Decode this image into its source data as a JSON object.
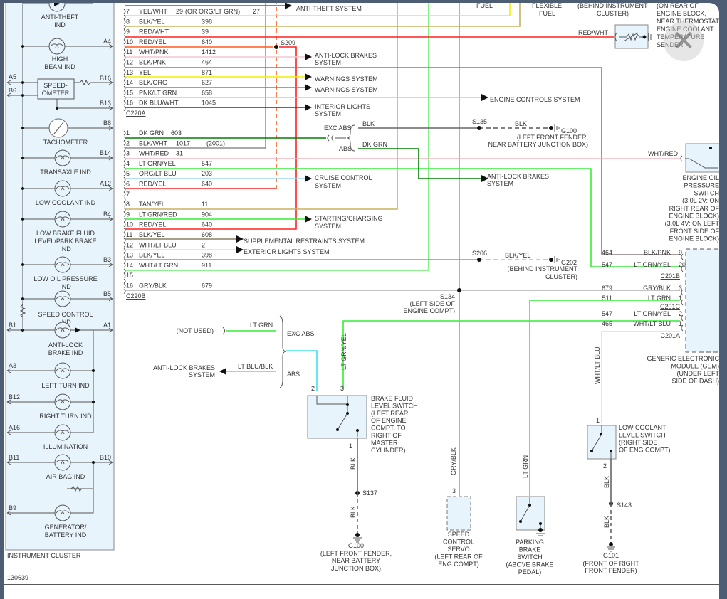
{
  "colors": {
    "frame": "#4d5d73",
    "cluster_fill": "#e8f4fc",
    "yellow": "#f0f000",
    "red": "#ff2020",
    "orange_red": "#ff5a1e",
    "pink": "#f4b4bc",
    "lt_green": "#33ee33",
    "dk_green": "#008000",
    "navy": "#1a3399",
    "gray": "#a0a0a0",
    "tan": "#c8b060",
    "cyan": "#40e0f0",
    "lt_blue": "#b8ecf4"
  },
  "figure_id": "130639",
  "cluster": {
    "label": "INSTRUMENT CLUSTER",
    "items": [
      {
        "label": [
          "ANTI-THEFT",
          "IND"
        ],
        "left": "",
        "right": ""
      },
      {
        "label": [
          "HIGH",
          "BEAM IND"
        ],
        "left": "",
        "right": "A4"
      },
      {
        "label": [
          "SPEED-",
          "OMETER"
        ],
        "left": "A5",
        "left2": "B6",
        "right": "B16",
        "right2": "B13"
      },
      {
        "label": [
          "TACHOMETER"
        ],
        "left": "",
        "right": "B8"
      },
      {
        "label": [
          "TRANSAXLE IND"
        ],
        "left": "",
        "right": "B14"
      },
      {
        "label": [
          "LOW COOLANT IND"
        ],
        "left": "",
        "right": "A12"
      },
      {
        "label": [
          "LOW BRAKE FLUID",
          "LEVEL/PARK BRAKE",
          "IND"
        ],
        "left": "",
        "right": "B4"
      },
      {
        "label": [
          "LOW OIL PRESSURE",
          "IND"
        ],
        "left": "",
        "right": "B3"
      },
      {
        "label": [
          "SPEED CONTROL",
          "IND"
        ],
        "left": "",
        "right": "B5"
      },
      {
        "label": [
          "ANTI-LOCK",
          "BRAKE IND"
        ],
        "left": "B1",
        "right": "A1"
      },
      {
        "label": [
          "LEFT TURN IND"
        ],
        "left": "A3",
        "right": ""
      },
      {
        "label": [
          "RIGHT TURN IND"
        ],
        "left": "B12",
        "right": ""
      },
      {
        "label": [
          "ILLUMINATION"
        ],
        "left": "A16",
        "right": ""
      },
      {
        "label": [
          "AIR BAG IND"
        ],
        "left": "B11",
        "right": "B10"
      },
      {
        "label": [
          "GENERATOR/",
          "BATTERY IND"
        ],
        "left": "B9",
        "right": ""
      }
    ]
  },
  "c220a": {
    "label": "C220A",
    "rows": [
      {
        "pin": "7",
        "color": "YEL/WHT",
        "circuit": "29",
        "note": "(OR ORG/LT GRN)",
        "circuit2": "27"
      },
      {
        "pin": "8",
        "color": "BLK/YEL",
        "circuit": "398"
      },
      {
        "pin": "9",
        "color": "RED/WHT",
        "circuit": "39"
      },
      {
        "pin": "10",
        "color": "RED/YEL",
        "circuit": "640"
      },
      {
        "pin": "11",
        "color": "WHT/PNK",
        "circuit": "1412"
      },
      {
        "pin": "12",
        "color": "BLK/PNK",
        "circuit": "464"
      },
      {
        "pin": "13",
        "color": "YEL",
        "circuit": "871"
      },
      {
        "pin": "14",
        "color": "BLK/ORG",
        "circuit": "627"
      },
      {
        "pin": "15",
        "color": "PNK/LT GRN",
        "circuit": "658"
      },
      {
        "pin": "16",
        "color": "DK BLU/WHT",
        "circuit": "1045"
      }
    ]
  },
  "c220b": {
    "label": "C220B",
    "rows": [
      {
        "pin": "1",
        "color": "DK GRN",
        "circuit": "603"
      },
      {
        "pin": "2",
        "color": "BLK/WHT",
        "circuit": "1017",
        "note": "(2001)"
      },
      {
        "pin": "3",
        "color": "WHT/RED",
        "circuit": "31"
      },
      {
        "pin": "4",
        "color": "LT GRN/YEL",
        "circuit": "547"
      },
      {
        "pin": "5",
        "color": "ORG/LT BLU",
        "circuit": "203"
      },
      {
        "pin": "6",
        "color": "RED/YEL",
        "circuit": "640"
      },
      {
        "pin": "7",
        "color": "",
        "circuit": ""
      },
      {
        "pin": "8",
        "color": "TAN/YEL",
        "circuit": "11"
      },
      {
        "pin": "9",
        "color": "LT GRN/RED",
        "circuit": "904"
      },
      {
        "pin": "10",
        "color": "RED/YEL",
        "circuit": "640"
      },
      {
        "pin": "11",
        "color": "BLK/YEL",
        "circuit": "608"
      },
      {
        "pin": "12",
        "color": "WHT/LT BLU",
        "circuit": "2"
      },
      {
        "pin": "13",
        "color": "BLK/YEL",
        "circuit": "398"
      },
      {
        "pin": "14",
        "color": "WHT/LT GRN",
        "circuit": "911"
      },
      {
        "pin": "15",
        "color": "",
        "circuit": ""
      },
      {
        "pin": "16",
        "color": "GRY/BLK",
        "circuit": "679"
      }
    ]
  },
  "systems": {
    "anti_theft": "ANTI-THEFT SYSTEM",
    "abs_1": [
      "ANTI-LOCK BRAKES",
      "SYSTEM"
    ],
    "warnings_1": "WARNINGS SYSTEM",
    "warnings_2": "WARNINGS SYSTEM",
    "engine_controls": "ENGINE CONTROLS SYSTEM",
    "interior_lights": [
      "INTERIOR LIGHTS",
      "SYSTEM"
    ],
    "cruise": [
      "CRUISE CONTROL",
      "SYSTEM"
    ],
    "starting": [
      "STARTING/CHARGING",
      "SYSTEM"
    ],
    "srs": "SUPPLEMENTAL RESTRAINTS SYSTEM",
    "exterior": "EXTERIOR LIGHTS SYSTEM",
    "abs_2": [
      "ANTI-LOCK BRAKES",
      "SYSTEM"
    ],
    "abs_3": [
      "ANTI-LOCK BRAKES",
      "SYSTEM"
    ]
  },
  "top": {
    "fuel": "FUEL",
    "flex": [
      "FLEXIBLE",
      "FUEL"
    ],
    "behind": [
      "(BEHIND INSTRUMENT",
      "CLUSTER)"
    ],
    "sender": [
      "(ON REAR OF",
      "ENGINE BLOCK,",
      "NEAR THERMOSTAT)",
      "ENGINE COOLANT",
      "TEMPERATURE",
      "SENDER"
    ],
    "red_wht": "RED/WHT"
  },
  "splices": {
    "s209": "S209",
    "s135": "S135",
    "s206": "S206",
    "s134": "S134",
    "s134_loc": [
      "(LEFT SIDE OF",
      "ENGINE COMPT)"
    ],
    "s137": "S137",
    "s143": "S143"
  },
  "abs_select": {
    "exc_abs": "EXC ABS",
    "abs": "ABS",
    "blk": "BLK",
    "dk_grn": "DK GRN"
  },
  "grounds": {
    "g100_top": {
      "wire": "BLK",
      "name": "G100",
      "loc": [
        "(LEFT FRONT FENDER,",
        "NEAR BATTERY JUNCTION BOX)"
      ]
    },
    "g202": {
      "wire": "BLK/YEL",
      "name": "G202",
      "loc": [
        "(BEHIND INSTRUMENT",
        "CLUSTER)"
      ]
    },
    "g100_bot": {
      "wire1": "BLK",
      "wire2": "BLK",
      "name": "G100",
      "loc": [
        "(LEFT FRONT FENDER,",
        "NEAR BATTERY",
        "JUNCTION BOX)"
      ]
    },
    "g101": {
      "wire1": "BLK",
      "wire2": "BLK",
      "name": "G101",
      "loc": [
        "(FRONT OF RIGHT",
        "FRONT FENDER)"
      ]
    }
  },
  "oil_switch": {
    "wire": "WHT/RED",
    "label": [
      "ENGINE OIL",
      "PRESSURE",
      "SWITCH",
      "(3.0L 2V: ON",
      "RIGHT REAR OF",
      "ENGINE BLOCK)",
      "(3.0L 4V: ON LEFT",
      "FRONT SIDE OF",
      "ENGINE BLOCK)"
    ]
  },
  "gem": {
    "label": [
      "GENERIC ELECTRONIC",
      "MODULE (GEM)",
      "(UNDER LEFT",
      "SIDE OF DASH)"
    ],
    "pins": [
      {
        "circuit": "464",
        "color": "BLK/PNK",
        "pin": "9"
      },
      {
        "circuit": "547",
        "color": "LT GRN/YEL",
        "pin": "20"
      },
      {
        "circuit": "679",
        "color": "GRY/BLK",
        "pin": "3"
      },
      {
        "circuit": "511",
        "color": "LT GRN",
        "pin": "1"
      },
      {
        "circuit": "547",
        "color": "LT GRN/YEL",
        "pin": "2"
      },
      {
        "circuit": "465",
        "color": "WHT/LT BLU",
        "pin": "1"
      }
    ],
    "connectors": [
      "C201B",
      "C201C",
      "C201A"
    ]
  },
  "brake_fluid": {
    "not_used": "(NOT USED)",
    "lt_grn": "LT GRN",
    "lt_blu_blk": "LT BLU/BLK",
    "exc_abs": "EXC ABS",
    "abs": "ABS",
    "pin2": "2",
    "pin3": "3",
    "pin1": "1",
    "wire3": "LT GRN/YEL",
    "label": [
      "BRAKE FLUID",
      "LEVEL SWITCH",
      "(LEFT REAR",
      "OF ENGINE",
      "COMPT, TO",
      "RIGHT OF",
      "MASTER",
      "CYLINDER)"
    ]
  },
  "servo": {
    "wire": "GRY/BLK",
    "pin": "3",
    "label": [
      "SPEED",
      "CONTROL",
      "SERVO",
      "(LEFT REAR OF",
      "ENG COMPT)"
    ]
  },
  "park_brake": {
    "wire": "LT GRN",
    "label": [
      "PARKING",
      "BRAKE",
      "SWITCH",
      "(ABOVE BRAKE",
      "PEDAL)"
    ]
  },
  "low_coolant": {
    "wire": "WHT/LT BLU",
    "pin1": "1",
    "pin2": "2",
    "label": [
      "LOW COOLANT",
      "LEVEL SWITCH",
      "(RIGHT SIDE",
      "OF ENG COMPT)"
    ]
  },
  "overlay": {
    "close": "✕"
  }
}
